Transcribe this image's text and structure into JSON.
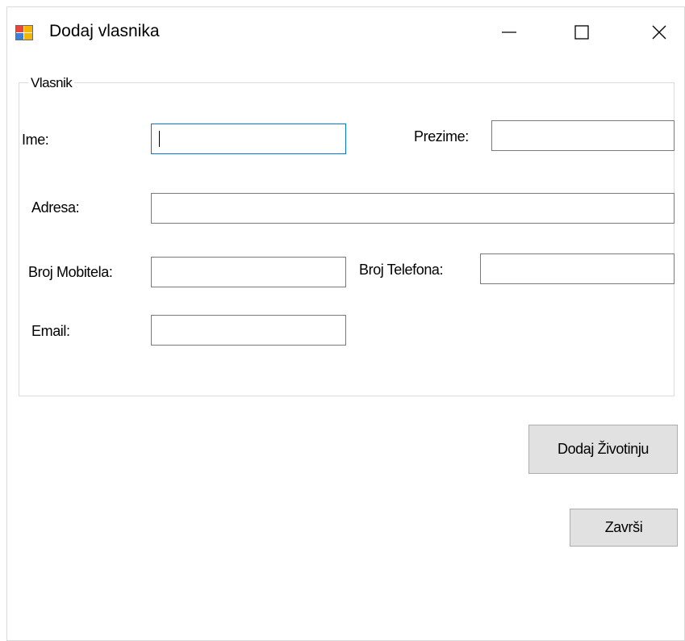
{
  "window": {
    "title": "Dodaj vlasnika",
    "icons": {
      "app": "windows-form-icon",
      "minimize": "minimize-icon",
      "maximize": "maximize-icon",
      "close": "close-icon"
    }
  },
  "group": {
    "title": "Vlasnik"
  },
  "fields": {
    "ime": {
      "label": "Ime:",
      "value": ""
    },
    "prezime": {
      "label": "Prezime:",
      "value": ""
    },
    "adresa": {
      "label": "Adresa:",
      "value": ""
    },
    "broj_mobitela": {
      "label": "Broj Mobitela:",
      "value": ""
    },
    "broj_telefona": {
      "label": "Broj Telefona:",
      "value": ""
    },
    "email": {
      "label": "Email:",
      "value": ""
    }
  },
  "buttons": {
    "dodaj_zivotinju": "Dodaj Životinju",
    "zavrsi": "Završi"
  },
  "colors": {
    "focus_border": "#0078d7",
    "button_bg": "#e1e1e1",
    "button_border": "#adadad"
  }
}
